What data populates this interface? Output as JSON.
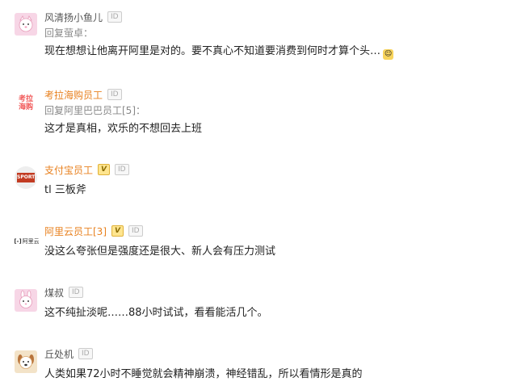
{
  "comments": [
    {
      "name": "风清扬小鱼儿",
      "id_badge": "ID",
      "reply": "回复萤卓：",
      "text": "现在想想让他离开阿里是对的。要不真心不知道要消费到何时才算个头…",
      "avatar_icon": "cat-icon",
      "avatar_bg": "#f7d6e6"
    },
    {
      "name": "考拉海购员工",
      "id_badge": "ID",
      "reply": "回复阿里巴巴员工[5]：",
      "text": "这才是真相，欢乐的不想回去上班",
      "avatar_text": "考拉\n海购",
      "avatar_icon": "kaola-logo",
      "name_color": "#e8811f"
    },
    {
      "name": "支付宝员工",
      "id_badge": "ID",
      "v_badge": "V",
      "text": "tl 三板斧",
      "avatar_text": "SPORT",
      "avatar_icon": "sport-badge-icon",
      "name_color": "#e8811f"
    },
    {
      "name": "阿里云员工[3]",
      "id_badge": "ID",
      "v_badge": "V",
      "text": "没这么夸张但是强度还是很大、新人会有压力测试",
      "avatar_text": "阿里云",
      "avatar_icon": "aliyun-logo",
      "name_color": "#e8811f"
    },
    {
      "name": "煤叔",
      "id_badge": "ID",
      "text": "这不纯扯淡呢……88小时试试，看看能活几个。",
      "avatar_icon": "bunny-icon",
      "avatar_bg": "#f7d6e6"
    },
    {
      "name": "丘处机",
      "id_badge": "ID",
      "text": "人类如果72小时不睡觉就会精神崩溃，神经错乱，所以看情形是真的",
      "avatar_icon": "dog-icon",
      "avatar_bg": "#f3e3c8"
    }
  ]
}
